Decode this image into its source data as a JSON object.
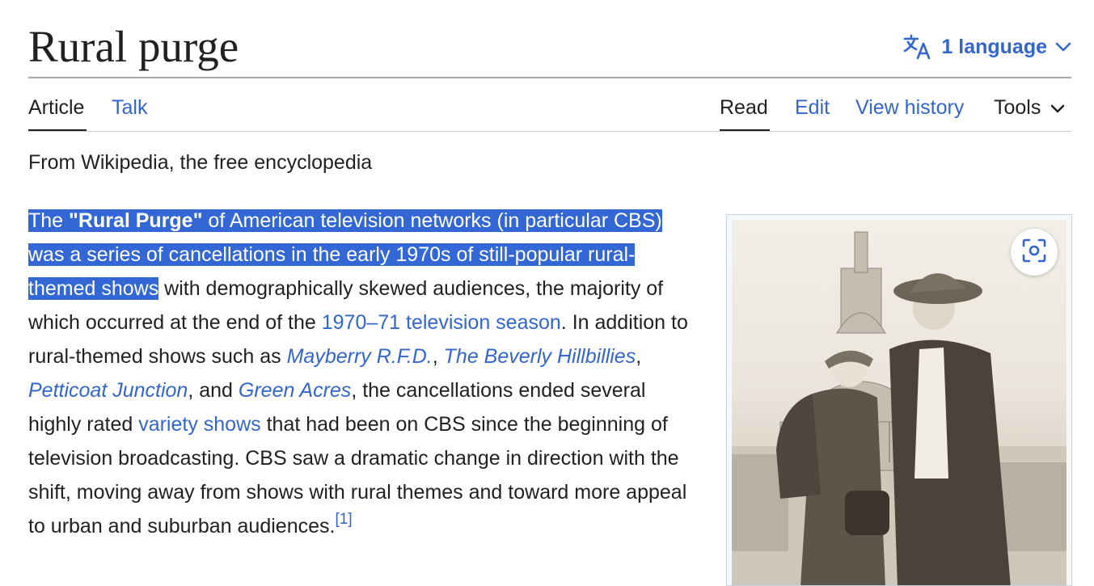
{
  "page": {
    "title": "Rural purge",
    "language_button": "1 language",
    "tagline": "From Wikipedia, the free encyclopedia"
  },
  "tabs": {
    "article": "Article",
    "talk": "Talk",
    "read": "Read",
    "edit": "Edit",
    "view_history": "View history",
    "tools": "Tools"
  },
  "lead": {
    "the": "The ",
    "q_open": "\"",
    "rural_purge": "Rural Purge",
    "q_close": "\"",
    "sel_1": " of American television networks (in particular CBS) was a series of cancellations in the early 1970s of still-popular rural-themed shows",
    "t1": " with demographically skewed audiences, the majority of which occurred at the end of the ",
    "link_season": "1970–71 television season",
    "t2": ". In addition to rural-themed shows such as ",
    "link_mayberry": "Mayberry R.F.D.",
    "t3": ", ",
    "link_beverly": "The Beverly Hillbillies",
    "t4": ", ",
    "link_petticoat": "Petticoat Junction",
    "t5": ", and ",
    "link_green": "Green Acres",
    "t6": ", the cancellations ended several highly rated ",
    "link_variety": "variety shows",
    "t7": " that had been on CBS since the beginning of television broadcasting. CBS saw a dramatic change in direction with the shift, moving away from shows with rural themes and toward more appeal to urban and suburban audiences.",
    "ref": "[1]"
  },
  "icons": {
    "language": "translate-icon",
    "chevron": "chevron-down-icon",
    "zoom": "image-zoom-icon"
  },
  "colors": {
    "link": "#3366cc",
    "selection": "#3367d6",
    "text": "#202122"
  }
}
